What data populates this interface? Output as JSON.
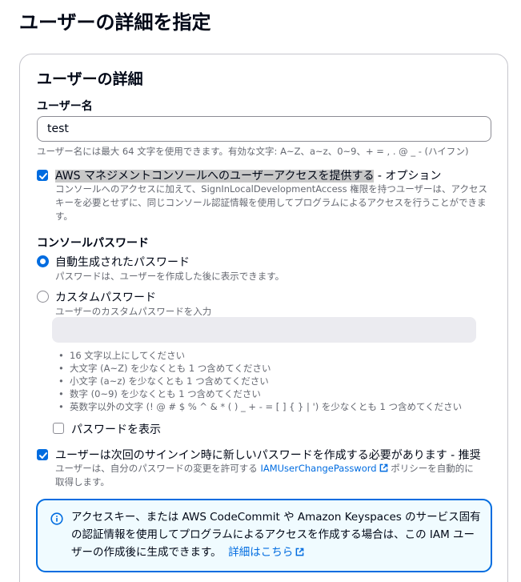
{
  "page": {
    "title": "ユーザーの詳細を指定"
  },
  "user_details": {
    "section_title": "ユーザーの詳細",
    "username_label": "ユーザー名",
    "username_value": "test",
    "username_hint": "ユーザー名には最大 64 文字を使用できます。有効な文字: A~Z、a~z、0~9、+ = , . @ _ - (ハイフン)"
  },
  "console_access": {
    "label_highlighted": "AWS マネジメントコンソールへのユーザーアクセスを提供する",
    "label_suffix": " - オプション",
    "checked": true,
    "description": "コンソールへのアクセスに加えて、SignInLocalDevelopmentAccess 権限を持つユーザーは、アクセスキーを必要とせずに、同じコンソール認証情報を使用してプログラムによるアクセスを行うことができます。"
  },
  "console_password": {
    "label": "コンソールパスワード",
    "options": [
      {
        "label": "自動生成されたパスワード",
        "description": "パスワードは、ユーザーを作成した後に表示できます。",
        "selected": true
      },
      {
        "label": "カスタムパスワード",
        "description": "ユーザーのカスタムパスワードを入力",
        "selected": false
      }
    ],
    "rules": [
      "16 文字以上にしてください",
      "大文字 (A~Z) を少なくとも 1 つ含めてください",
      "小文字 (a~z) を少なくとも 1 つ含めてください",
      "数字 (0~9) を少なくとも 1 つ含めてください",
      "英数字以外の文字 (! @ # $ % ^ & * ( ) _ + - = [ ] { } | ') を少なくとも 1 つ含めてください"
    ],
    "show_password_label": "パスワードを表示",
    "show_password_checked": false
  },
  "reset_password": {
    "label": "ユーザーは次回のサインイン時に新しいパスワードを作成する必要があります - 推奨",
    "checked": true,
    "description_prefix": "ユーザーは、自分のパスワードの変更を許可する ",
    "policy_link": "IAMUserChangePassword",
    "description_suffix_line1": " ポリシーを自動的に",
    "description_suffix_line2": "取得します。"
  },
  "info_alert": {
    "text": "アクセスキー、または AWS CodeCommit や Amazon Keyspaces のサービス固有の認証情報を使用してプログラムによるアクセスを作成する場合は、この IAM ユーザーの作成後に生成できます。",
    "link_label": "詳細はこちら"
  },
  "colors": {
    "accent": "#006ce0",
    "text": "#000716",
    "muted": "#656871",
    "info_bg": "#f0fbff"
  },
  "icons": [
    "check-icon",
    "external-link-icon",
    "info-icon"
  ]
}
